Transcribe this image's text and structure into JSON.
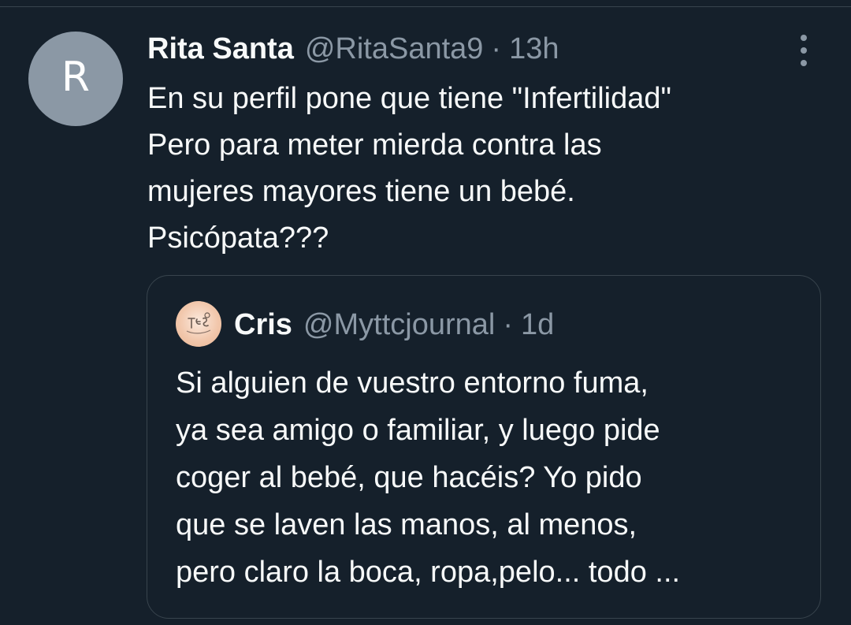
{
  "tweet": {
    "avatar_letter": "R",
    "display_name": "Rita Santa",
    "handle": "@RitaSanta9",
    "separator": "·",
    "time": "13h",
    "text_lines": [
      "En su perfil pone que tiene \"Infertilidad\"",
      "Pero para meter mierda contra las",
      "mujeres mayores tiene un bebé.",
      "Psicópata???"
    ]
  },
  "quoted_tweet": {
    "display_name": "Cris",
    "handle": "@Myttcjournal",
    "separator": "·",
    "time": "1d",
    "text_lines": [
      "Si alguien de vuestro entorno fuma,",
      "ya sea amigo o familiar, y luego pide",
      "coger al bebé, que hacéis? Yo pido",
      "que se laven las manos, al menos,",
      "pero claro la boca, ropa,pelo... todo ..."
    ]
  },
  "icons": {
    "more": "more-vertical-icon"
  },
  "colors": {
    "background": "#15202b",
    "primary_text": "#f7f9f9",
    "secondary_text": "#8b98a5",
    "border": "#38444d",
    "avatar_bg": "#8b98a5"
  }
}
